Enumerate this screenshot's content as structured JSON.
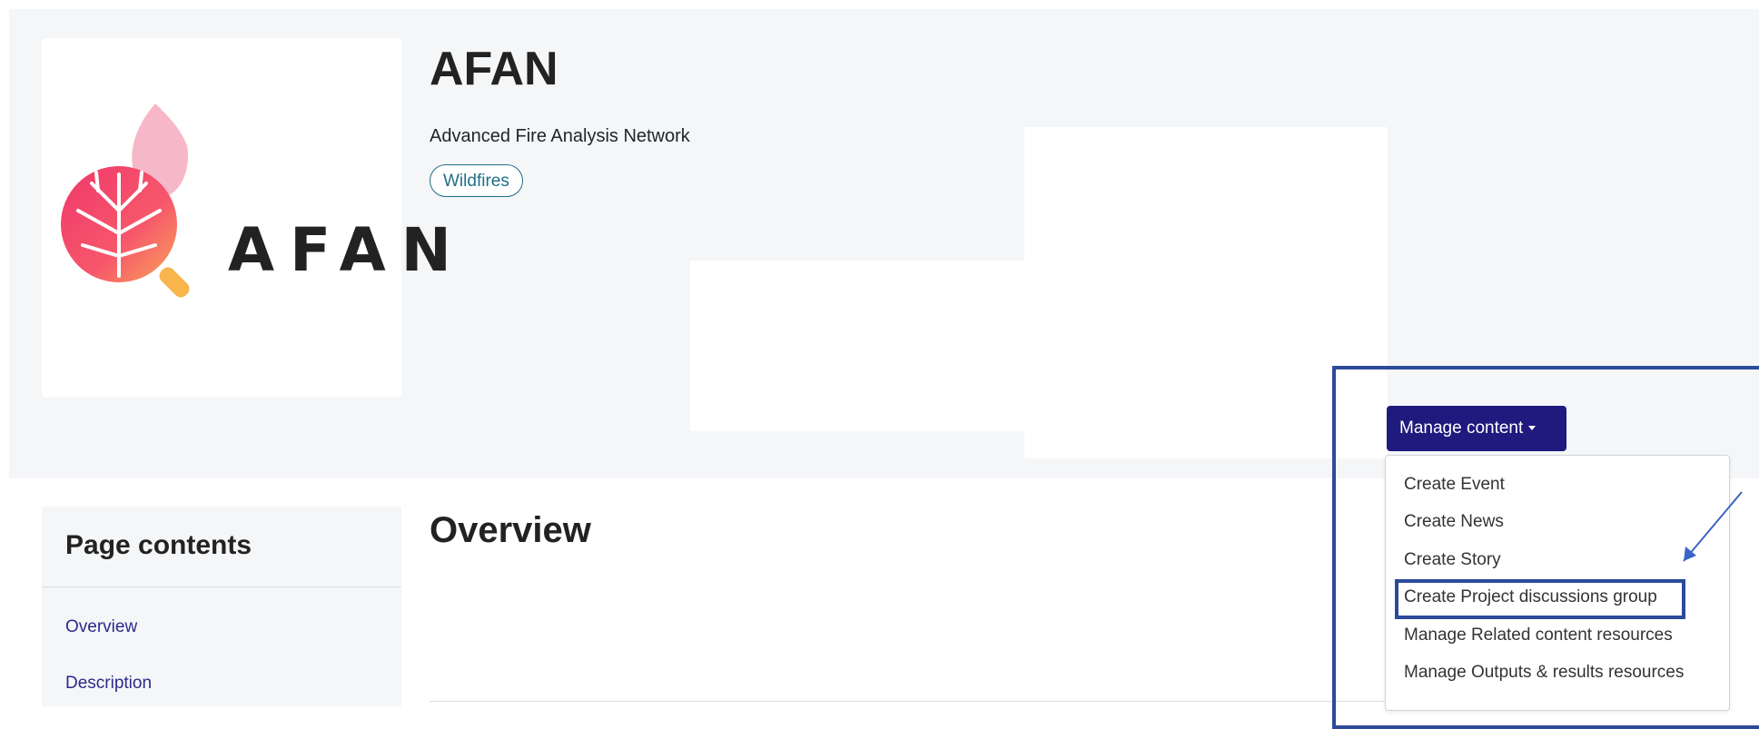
{
  "header": {
    "logo_text": "AFAN",
    "title": "AFAN",
    "subtitle": "Advanced Fire Analysis Network",
    "tag": "Wildfires"
  },
  "sidebar": {
    "title": "Page contents",
    "links": [
      "Overview",
      "Description"
    ]
  },
  "main": {
    "section_title": "Overview"
  },
  "manage": {
    "button_label": "Manage content",
    "menu_items": [
      "Create Event",
      "Create News",
      "Create Story",
      "Create Project discussions group",
      "Manage Related content resources",
      "Manage Outputs & results resources"
    ],
    "highlighted_item": "Create Project discussions group"
  },
  "colors": {
    "button_bg": "#1f1a7d",
    "link": "#2b2a8a",
    "tag": "#1f6f86",
    "annotation": "#2d4a9a",
    "hero_bg": "#f5f6f8"
  },
  "icons": {
    "logo": "afan-leaf-logo-icon",
    "caret": "caret-down-icon",
    "annotation_arrow": "arrow-icon"
  }
}
